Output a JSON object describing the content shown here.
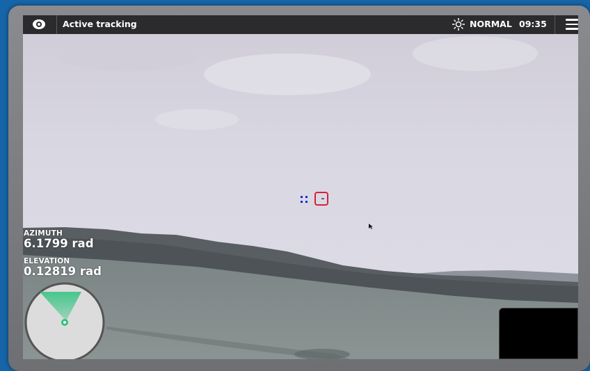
{
  "topbar": {
    "title": "Active tracking",
    "mode": "NORMAL",
    "time": "09:35",
    "icons": {
      "left": "eye-icon",
      "mode": "sun-icon",
      "menu": "hamburger-menu-icon"
    }
  },
  "telemetry": {
    "azimuth_label": "AZIMUTH",
    "azimuth_value": "6.1799 rad",
    "elevation_label": "ELEVATION",
    "elevation_value": "0.12819 rad"
  },
  "colors": {
    "target_box": "#d81f3a",
    "prediction_marker": "#1a2bd6",
    "radar_cone": "#2ec27e",
    "topbar": "#2b2b2d",
    "frame_background": "#1565a8"
  }
}
